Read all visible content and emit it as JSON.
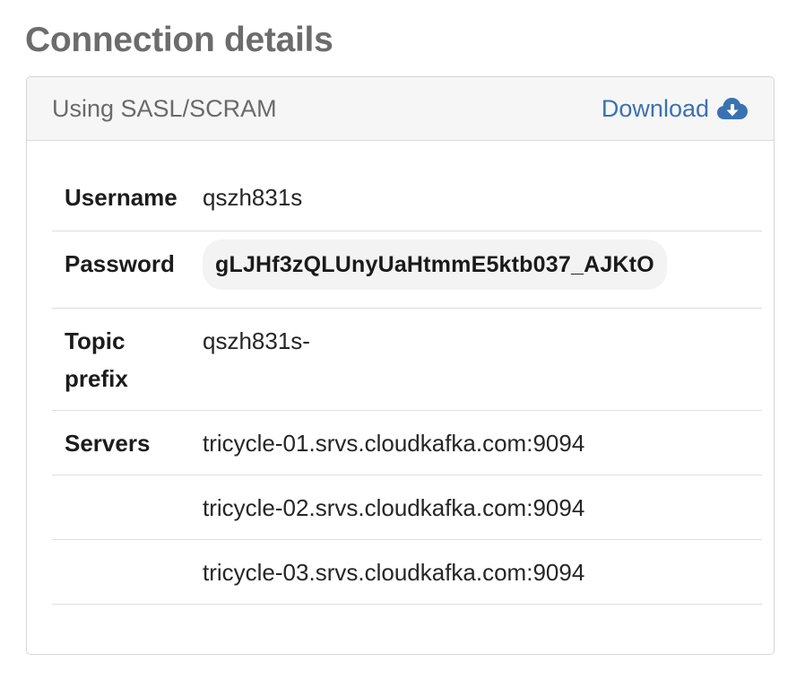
{
  "page": {
    "title": "Connection details"
  },
  "card": {
    "auth_method": "Using SASL/SCRAM",
    "download_label": "Download",
    "download_icon": "cloud-download-icon",
    "accent_color": "#3a72b1"
  },
  "details": {
    "username_label": "Username",
    "username_value": "qszh831s",
    "password_label": "Password",
    "password_value": "gLJHf3zQLUnyUaHtmmE5ktb037_AJKtO",
    "topic_prefix_label_line1": "Topic",
    "topic_prefix_label_line2": "prefix",
    "topic_prefix_value": "qszh831s-",
    "servers_label": "Servers",
    "servers": [
      "tricycle-01.srvs.cloudkafka.com:9094",
      "tricycle-02.srvs.cloudkafka.com:9094",
      "tricycle-03.srvs.cloudkafka.com:9094"
    ]
  }
}
